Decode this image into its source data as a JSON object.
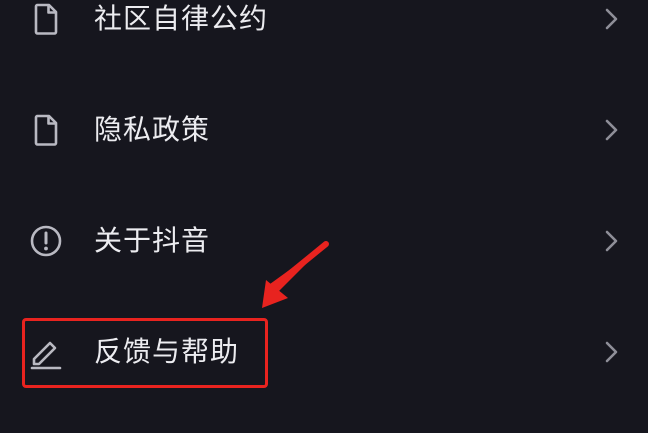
{
  "menu": {
    "items": [
      {
        "label": "社区自律公约",
        "icon": "document-icon"
      },
      {
        "label": "隐私政策",
        "icon": "document-icon"
      },
      {
        "label": "关于抖音",
        "icon": "info-circle-icon"
      },
      {
        "label": "反馈与帮助",
        "icon": "edit-pencil-icon"
      }
    ]
  },
  "annotation": {
    "color": "#e8231f",
    "target": "反馈与帮助"
  },
  "colors": {
    "background": "#16161e",
    "text": "#ececf0",
    "icon": "#b9b9c2",
    "chevron": "#8e8e98"
  }
}
